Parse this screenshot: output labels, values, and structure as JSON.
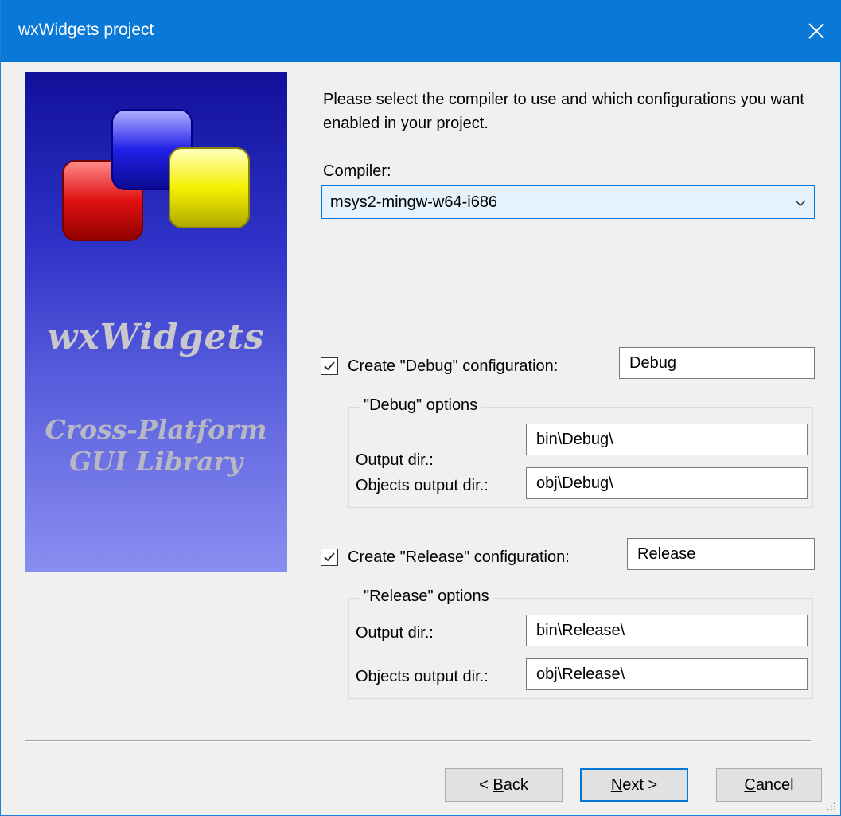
{
  "window": {
    "title": "wxWidgets project"
  },
  "banner": {
    "name": "wxWidgets",
    "tagline_line1": "Cross-Platform",
    "tagline_line2": "GUI Library"
  },
  "intro_text": "Please select the compiler to use and which configurations you want enabled in your project.",
  "compiler": {
    "label": "Compiler:",
    "value": "msys2-mingw-w64-i686"
  },
  "debug": {
    "checkbox_label": "Create \"Debug\" configuration:",
    "checked": true,
    "name_value": "Debug",
    "group_title": "\"Debug\" options",
    "output_label": "Output dir.:",
    "output_value": "bin\\Debug\\",
    "objects_label": "Objects output dir.:",
    "objects_value": "obj\\Debug\\"
  },
  "release": {
    "checkbox_label": "Create \"Release\" configuration:",
    "checked": true,
    "name_value": "Release",
    "group_title": "\"Release\" options",
    "output_label": "Output dir.:",
    "output_value": "bin\\Release\\",
    "objects_label": "Objects output dir.:",
    "objects_value": "obj\\Release\\"
  },
  "buttons": {
    "back_prefix": "< ",
    "back_mnemonic": "B",
    "back_rest": "ack",
    "next_mnemonic": "N",
    "next_rest": "ext >",
    "cancel_mnemonic": "C",
    "cancel_rest": "ancel"
  },
  "colors": {
    "titlebar": "#0a78d7",
    "accent": "#0078d7",
    "banner_top": "#10109a",
    "banner_bottom": "#8a8ef0"
  }
}
